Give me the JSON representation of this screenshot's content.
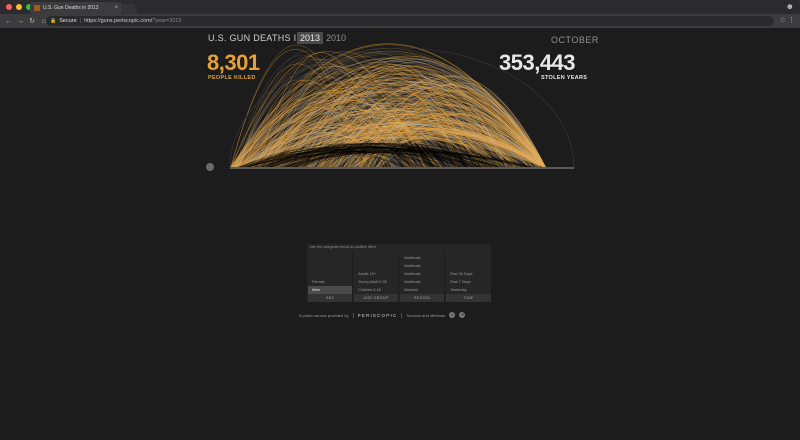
{
  "browser": {
    "tab_title": "U.S. Gun Deaths in 2013",
    "tab_close": "×",
    "secure_label": "Secure",
    "url_host": "https://guns.periscopic.com/",
    "url_query": "?year=2013",
    "colors": {
      "close": "#ff5f57",
      "minimize": "#febc2e",
      "maximize": "#28c840"
    }
  },
  "header": {
    "title": "U.S. GUN DEATHS IN",
    "years": [
      "2013",
      "2010"
    ],
    "active_year": "2013",
    "month": "OCTOBER"
  },
  "stats": {
    "killed_value": "8,301",
    "killed_label": "PEOPLE KILLED",
    "stolen_value": "353,443",
    "stolen_label": "STOLEN YEARS"
  },
  "colors": {
    "killed": "#e7a036",
    "stolen": "#d9d9d9",
    "background": "#1c1c1c"
  },
  "filters": {
    "hint": "Use the categories below as additive filters",
    "columns": [
      {
        "heading": "SEX",
        "options": [
          "Female",
          "Male"
        ],
        "selected": "Male"
      },
      {
        "heading": "AGE GROUP",
        "options": [
          "Adults 19+",
          "Young Adult 0-35",
          "Children 0-18"
        ],
        "selected": ""
      },
      {
        "heading": "REGION",
        "options": [
          "Northeast",
          "Northeast",
          "Northeast",
          "Northeast",
          "Midwest"
        ],
        "selected": ""
      },
      {
        "heading": "TIME",
        "options": [
          "Past 30 Days",
          "Past 7 Days",
          "Yesterday"
        ],
        "selected": ""
      }
    ]
  },
  "footer": {
    "provided_by": "A public service provided by",
    "brand": "PERISCOPIC",
    "sources": "Sources and Methods",
    "icons": [
      "info-icon",
      "share-icon"
    ]
  }
}
